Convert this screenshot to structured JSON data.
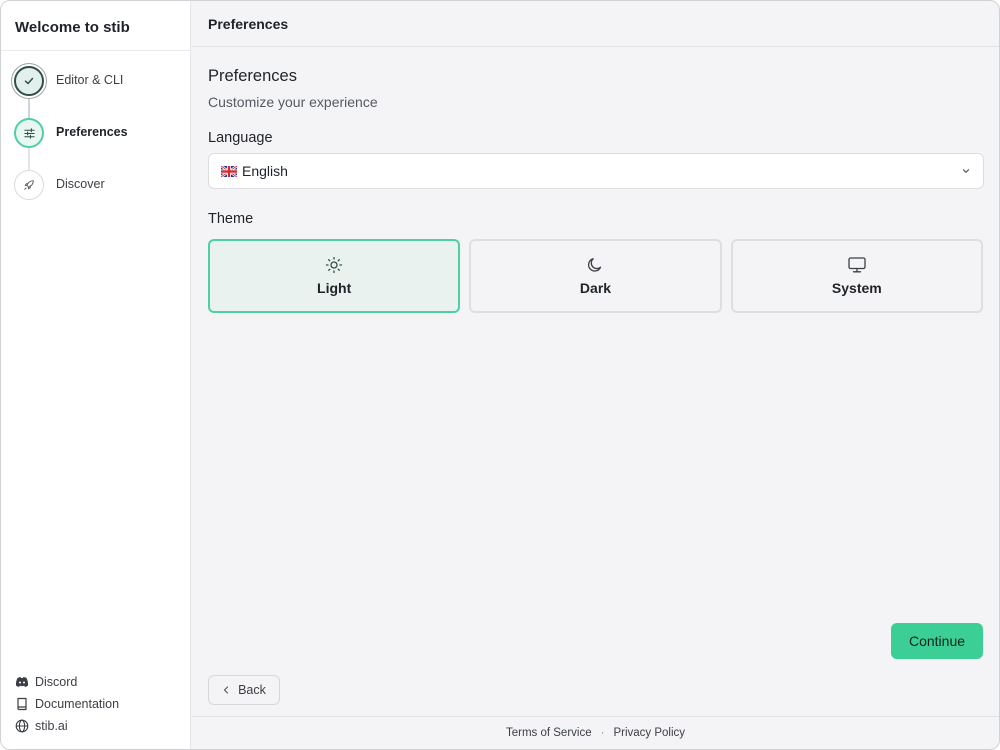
{
  "sidebar": {
    "title": "Welcome to stib",
    "steps": [
      {
        "label": "Editor & CLI",
        "state": "done",
        "icon": "check-icon"
      },
      {
        "label": "Preferences",
        "state": "current",
        "icon": "sliders-icon"
      },
      {
        "label": "Discover",
        "state": "upcoming",
        "icon": "rocket-icon"
      }
    ],
    "links": [
      {
        "label": "Discord",
        "icon": "discord-icon"
      },
      {
        "label": "Documentation",
        "icon": "book-icon"
      },
      {
        "label": "stib.ai",
        "icon": "globe-icon"
      }
    ]
  },
  "header": {
    "title": "Preferences"
  },
  "main": {
    "heading": "Preferences",
    "subtitle": "Customize your experience",
    "language": {
      "label": "Language",
      "value": "English",
      "flag_icon": "uk-flag-icon"
    },
    "theme": {
      "label": "Theme",
      "options": [
        {
          "label": "Light",
          "icon": "sun-icon",
          "selected": true
        },
        {
          "label": "Dark",
          "icon": "moon-icon",
          "selected": false
        },
        {
          "label": "System",
          "icon": "monitor-icon",
          "selected": false
        }
      ]
    }
  },
  "actions": {
    "continue_label": "Continue",
    "back_label": "Back"
  },
  "footer": {
    "terms": "Terms of Service",
    "separator": "·",
    "privacy": "Privacy Policy"
  },
  "colors": {
    "accent": "#3ccf95",
    "accent_border": "#4fd0a4",
    "selected_bg": "#e9f2ef"
  }
}
